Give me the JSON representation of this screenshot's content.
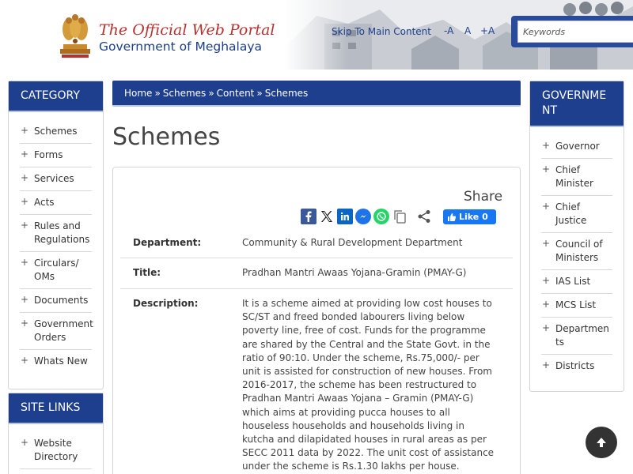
{
  "header": {
    "title": "The Official Web Portal",
    "subtitle": "Government of Meghalaya",
    "skip_link": "Skip To Main Content",
    "font_decrease": "-A",
    "font_normal": "A",
    "font_increase": "+A",
    "search_placeholder": "Keywords"
  },
  "left_panels": {
    "category": {
      "title": "CATEGORY",
      "items": [
        {
          "label": "Schemes"
        },
        {
          "label": "Forms"
        },
        {
          "label": "Services"
        },
        {
          "label": "Acts"
        },
        {
          "label": "Rules and Regulations"
        },
        {
          "label": "Circulars/ OMs"
        },
        {
          "label": "Documents"
        },
        {
          "label": "Government Orders"
        },
        {
          "label": "Whats New"
        }
      ]
    },
    "site_links": {
      "title": "SITE LINKS",
      "items": [
        {
          "label": "Website Directory"
        }
      ]
    }
  },
  "right_panel": {
    "title": "GOVERNMENT",
    "items": [
      {
        "label": "Governor"
      },
      {
        "label": "Chief Minister"
      },
      {
        "label": "Chief Justice"
      },
      {
        "label": "Council of Ministers"
      },
      {
        "label": "IAS List"
      },
      {
        "label": "MCS List"
      },
      {
        "label": "Departments"
      },
      {
        "label": "Districts"
      }
    ]
  },
  "breadcrumb": [
    "Home",
    "Schemes",
    "Content",
    "Schemes"
  ],
  "breadcrumb_separator": "»",
  "page_title": "Schemes",
  "share": {
    "label": "Share",
    "icons": [
      "facebook-icon",
      "x-twitter-icon",
      "linkedin-icon",
      "messenger-icon",
      "whatsapp-icon",
      "copy-icon",
      "share-icon"
    ],
    "fb_like_label": "Like 0"
  },
  "details": {
    "department_label": "Department:",
    "department_value": "Community & Rural Development Department",
    "title_label": "Title:",
    "title_value": "Pradhan Mantri Awaas Yojana-Gramin (PMAY-G)",
    "description_label": "Description:",
    "description_value": "It is a scheme aimed at providing low cost houses to SC/ST and freed bonded labourers living below poverty line, free of cost. Funds for the programme are shared by the Central and the State Govt. in the ratio of 90:10. Under the scheme, Rs.75,000/- per unit is assisted for construction of new houses. From 2016-2017, the scheme has been restructured to Pradhan Mantri Awaas Yojana – Gramin (PMAY-G) which aims at providing pucca houses to all houseless households and households living in kutcha and dilapidated houses in rural areas as per SECC 2011 data by 2022. The unit cost of assistance under the scheme is Rs.1.30 lakhs per house."
  },
  "colors": {
    "brand_blue": "#1d3f8e",
    "title_red": "#b5322e"
  }
}
